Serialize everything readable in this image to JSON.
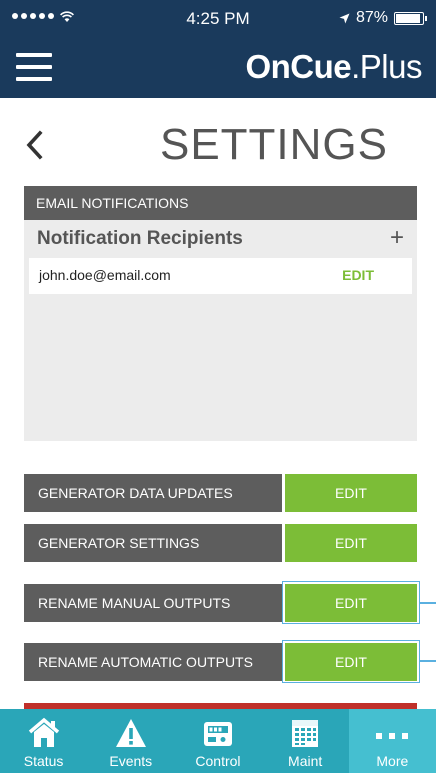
{
  "status_bar": {
    "time": "4:25 PM",
    "battery": "87%"
  },
  "header": {
    "brand_bold": "OnCue",
    "brand_light": ".Plus"
  },
  "page": {
    "title": "SETTINGS"
  },
  "email_notifications": {
    "header": "EMAIL NOTIFICATIONS",
    "recipients_title": "Notification Recipients",
    "add_label": "+",
    "recipients": [
      {
        "email": "john.doe@email.com",
        "edit_label": "EDIT"
      }
    ]
  },
  "settings_rows": [
    {
      "label": "GENERATOR DATA UPDATES",
      "edit_label": "EDIT"
    },
    {
      "label": "GENERATOR SETTINGS",
      "edit_label": "EDIT"
    },
    {
      "label": "RENAME MANUAL OUTPUTS",
      "edit_label": "EDIT"
    },
    {
      "label": "RENAME AUTOMATIC OUTPUTS",
      "edit_label": "EDIT"
    }
  ],
  "tabs": [
    {
      "label": "Status",
      "icon": "home-icon"
    },
    {
      "label": "Events",
      "icon": "warning-icon"
    },
    {
      "label": "Control",
      "icon": "control-panel-icon"
    },
    {
      "label": "Maint",
      "icon": "calendar-icon"
    },
    {
      "label": "More",
      "icon": "more-icon",
      "active": true
    }
  ],
  "colors": {
    "header_bg": "#1a3a5c",
    "accent_green": "#7cbd37",
    "row_gray": "#5d5d5d",
    "tabbar": "#2aa6b8",
    "tab_active": "#45bfd0",
    "highlight": "#5ab0e0"
  }
}
